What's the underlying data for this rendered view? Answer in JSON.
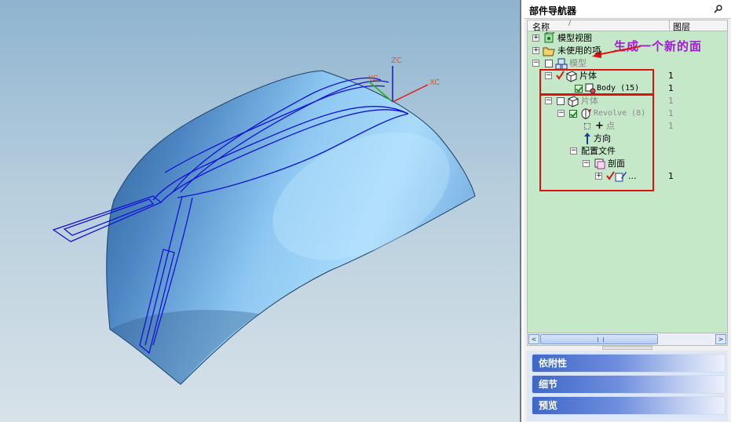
{
  "viewport": {
    "axes": {
      "zc": "ZC",
      "yc": "YC",
      "xc": "XC"
    }
  },
  "navigator": {
    "title": "部件导航器",
    "columns": {
      "name": "名称",
      "sort_indicator": "/",
      "layer": "图层"
    },
    "annotation": "生成一个新的面",
    "tree": {
      "model_views": "模型视图",
      "unused_items": "未使用的项",
      "model": "模型",
      "sheet_body_1": "片体",
      "sheet_body_1_layer": "1",
      "body_15": "Body (15)",
      "body_15_layer": "1",
      "sheet_body_2": "片体",
      "sheet_body_2_layer": "1",
      "revolve": "Revolve (8)",
      "revolve_layer": "1",
      "point": "点",
      "point_layer": "1",
      "direction": "方向",
      "profile": "配置文件",
      "section": "剖面",
      "sketch_item": "...",
      "sketch_item_layer": "1"
    },
    "panels": {
      "dependencies": "依附性",
      "details": "细节",
      "preview": "预览"
    },
    "scrollbar": {
      "left_arrow": "<",
      "right_arrow": ">"
    }
  },
  "colors": {
    "tree_background": "#c4e8c8",
    "annotation": "#a21ad6",
    "highlight_box": "#e01010",
    "surface": "#5a93d0",
    "wireframe": "#1010d0"
  }
}
